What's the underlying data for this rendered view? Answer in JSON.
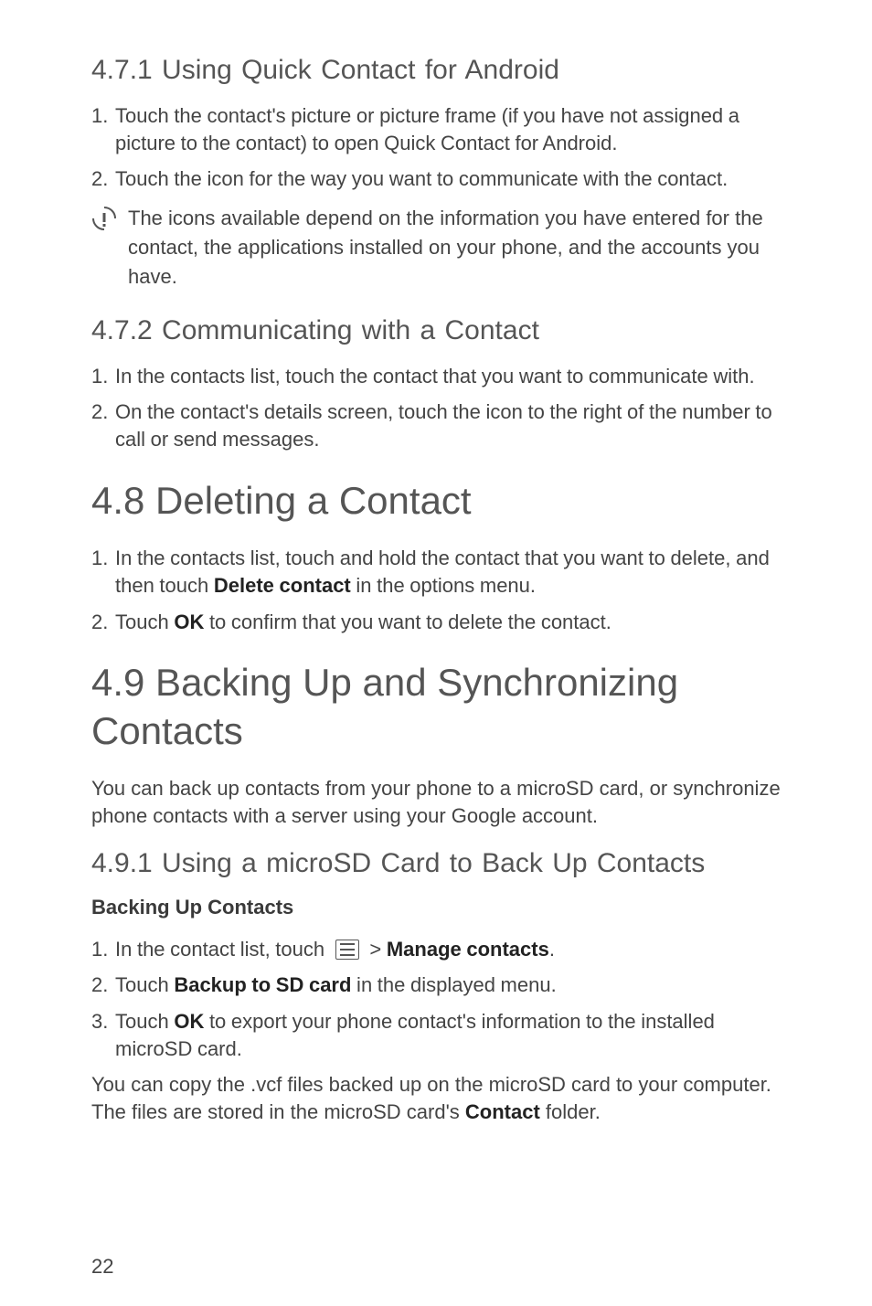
{
  "section_471": {
    "heading": "4.7.1  Using Quick Contact for Android",
    "items": [
      {
        "n": "1.",
        "text": "Touch the contact's picture or picture frame (if you have not assigned a picture to the contact) to open Quick Contact for Android."
      },
      {
        "n": "2.",
        "text": "Touch the icon for the way you want to communicate with the contact."
      }
    ],
    "note": "The icons available depend on the information you have entered for the contact, the applications installed on your phone, and the accounts you have."
  },
  "section_472": {
    "heading": "4.7.2  Communicating with a Contact",
    "items": [
      {
        "n": "1.",
        "text": "In the contacts list, touch the contact that you want to communicate with."
      },
      {
        "n": "2.",
        "text": "On the contact's details screen, touch the icon to the right of the number to call or send messages."
      }
    ]
  },
  "section_48": {
    "heading": "4.8  Deleting a Contact",
    "items": [
      {
        "n": "1.",
        "pre": "In the contacts list, touch and hold the contact that you want to delete, and then touch ",
        "bold": "Delete contact",
        "post": " in the options menu."
      },
      {
        "n": "2.",
        "pre": "Touch ",
        "bold": "OK",
        "post": " to confirm that you want to delete the contact."
      }
    ]
  },
  "section_49": {
    "heading": "4.9  Backing Up and Synchronizing Contacts",
    "intro": "You can back up contacts from your phone to a microSD card, or synchronize phone contacts with a server using your Google account."
  },
  "section_491": {
    "heading": "4.9.1  Using a microSD Card to Back Up Contacts",
    "subheading": "Backing Up Contacts",
    "items": [
      {
        "n": "1.",
        "pre": "In the contact list, touch ",
        "icon": "menu-icon",
        "bold": "Manage contacts",
        "gt": " > ",
        "post": "."
      },
      {
        "n": "2.",
        "pre": "Touch ",
        "bold": "Backup to SD card",
        "post": " in the displayed menu."
      },
      {
        "n": "3.",
        "pre": "Touch ",
        "bold": "OK",
        "post": " to export your phone contact's information to the installed microSD card."
      }
    ],
    "closing_pre": "You can copy the .vcf files backed up on the microSD card to your computer. The files are stored in the microSD card's ",
    "closing_bold": "Contact",
    "closing_post": " folder."
  },
  "page_number": "22"
}
